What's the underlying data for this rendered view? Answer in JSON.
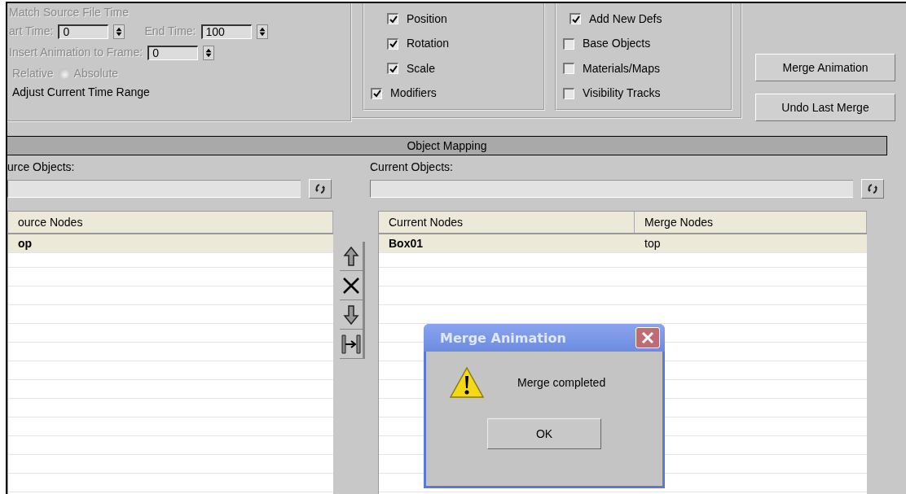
{
  "time_panel": {
    "disabled": true,
    "match_label": "Match Source File Time",
    "start": {
      "label": "art Time:",
      "value": "0"
    },
    "end": {
      "label": "End Time:",
      "value": "100"
    },
    "insert": {
      "label": "Insert Animation to Frame:",
      "value": "0"
    },
    "relative_label": "Relative",
    "absolute": {
      "label": "Absolute",
      "selected": false
    },
    "adjust_label": "Adjust Current Time Range"
  },
  "transform_tracks": [
    {
      "label": "Position",
      "checked": true
    },
    {
      "label": "Rotation",
      "checked": true
    },
    {
      "label": "Scale",
      "checked": true
    }
  ],
  "modifiers": {
    "label": "Modifiers",
    "checked": true
  },
  "merge_options": [
    {
      "label": "Add New Defs",
      "checked": true
    },
    {
      "label": "Base Objects",
      "checked": false
    },
    {
      "label": "Materials/Maps",
      "checked": false
    },
    {
      "label": "Visibility Tracks",
      "checked": false
    }
  ],
  "buttons": [
    "Merge Animation",
    "Undo Last Merge"
  ],
  "object_mapping": {
    "title": "Object Mapping",
    "source_label": "urce Objects:",
    "current_label": "Current Objects:",
    "source_list": {
      "columns": [
        "ource Nodes"
      ],
      "rows": [
        {
          "cells": [
            "op"
          ],
          "selected": true
        }
      ]
    },
    "current_list": {
      "columns": [
        "Current Nodes",
        "Merge Nodes"
      ],
      "rows": [
        {
          "cells": [
            "Box01",
            "top"
          ],
          "selected": true
        }
      ]
    }
  },
  "dialog": {
    "title": "Merge Animation",
    "message": "Merge completed",
    "button": "OK"
  }
}
